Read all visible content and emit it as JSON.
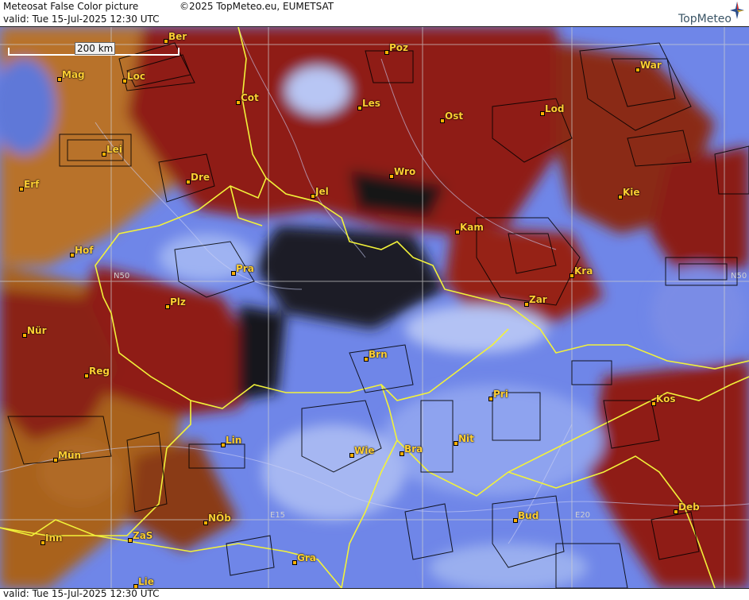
{
  "header": {
    "title": "Meteosat False Color picture",
    "valid": "valid:  Tue  15-Jul-2025  12:30 UTC",
    "copyright": "©2025 TopMeteo.eu, EUMETSAT",
    "logo_text": "TopMeteo"
  },
  "footer": {
    "valid": "valid:  Tue  15-Jul-2025  12:30 UTC"
  },
  "scale": {
    "label": "200 km"
  },
  "grid_labels": {
    "n50_left": "N50",
    "n50_right": "N50",
    "e15": "E15",
    "e20": "E20"
  },
  "cities": [
    {
      "id": "ber",
      "label": "Ber"
    },
    {
      "id": "poz",
      "label": "Poz"
    },
    {
      "id": "mag",
      "label": "Mag"
    },
    {
      "id": "loc",
      "label": "Loc"
    },
    {
      "id": "war",
      "label": "War"
    },
    {
      "id": "cot",
      "label": "Cot"
    },
    {
      "id": "les",
      "label": "Les"
    },
    {
      "id": "ost",
      "label": "Ost"
    },
    {
      "id": "lod",
      "label": "Lod"
    },
    {
      "id": "lei",
      "label": "Lei"
    },
    {
      "id": "dre",
      "label": "Dre"
    },
    {
      "id": "wro",
      "label": "Wro"
    },
    {
      "id": "erf",
      "label": "Erf"
    },
    {
      "id": "jel",
      "label": "Jel"
    },
    {
      "id": "kie",
      "label": "Kie"
    },
    {
      "id": "kam",
      "label": "Kam"
    },
    {
      "id": "hof",
      "label": "Hof"
    },
    {
      "id": "pra",
      "label": "Pra"
    },
    {
      "id": "kra",
      "label": "Kra"
    },
    {
      "id": "plz",
      "label": "Plz"
    },
    {
      "id": "zar",
      "label": "Zar"
    },
    {
      "id": "nur",
      "label": "Nür"
    },
    {
      "id": "brn",
      "label": "Brn"
    },
    {
      "id": "reg",
      "label": "Reg"
    },
    {
      "id": "pri",
      "label": "Pri"
    },
    {
      "id": "kos",
      "label": "Kos"
    },
    {
      "id": "lin",
      "label": "Lin"
    },
    {
      "id": "nit",
      "label": "Nit"
    },
    {
      "id": "wie",
      "label": "Wie"
    },
    {
      "id": "bra",
      "label": "Bra"
    },
    {
      "id": "mun",
      "label": "Mün"
    },
    {
      "id": "deb",
      "label": "Deb"
    },
    {
      "id": "nob",
      "label": "NÖb"
    },
    {
      "id": "bud",
      "label": "Bud"
    },
    {
      "id": "inn",
      "label": "Inn"
    },
    {
      "id": "zas",
      "label": "ZaS"
    },
    {
      "id": "gra",
      "label": "Gra"
    },
    {
      "id": "lie",
      "label": "Lie"
    }
  ],
  "colors": {
    "cloud_blue": "#6f86e8",
    "cloud_white": "#c6d0f5",
    "land_red": "#8e1d10",
    "land_orange": "#b56a1f",
    "border_yellow": "#f2f23a",
    "city_label": "#ffcf33"
  }
}
